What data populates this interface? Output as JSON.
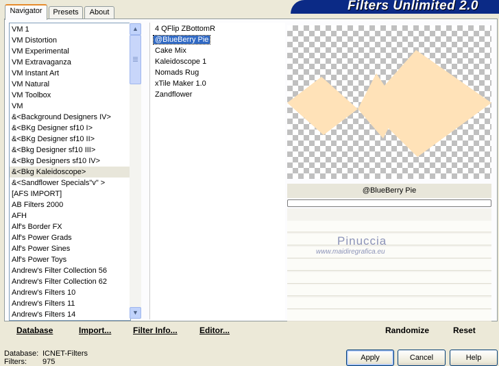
{
  "banner": {
    "title": "Filters Unlimited 2.0"
  },
  "tabs": [
    {
      "label": "Navigator",
      "active": true
    },
    {
      "label": "Presets",
      "active": false
    },
    {
      "label": "About",
      "active": false
    }
  ],
  "categories": {
    "items": [
      "VM 1",
      "VM Distortion",
      "VM Experimental",
      "VM Extravaganza",
      "VM Instant Art",
      "VM Natural",
      "VM Toolbox",
      "VM",
      "&<Background Designers IV>",
      "&<BKg Designer sf10 I>",
      "&<BKg Designer sf10 II>",
      "&<Bkg Designer sf10 III>",
      "&<Bkg Designers sf10 IV>",
      "&<Bkg Kaleidoscope>",
      "&<Sandflower Specials\"v\" >",
      "[AFS IMPORT]",
      "AB Filters 2000",
      "AFH",
      "Alf's Border FX",
      "Alf's Power Grads",
      "Alf's Power Sines",
      "Alf's Power Toys",
      "Andrew's Filter Collection 56",
      "Andrew's Filter Collection 62",
      "Andrew's Filters 10",
      "Andrew's Filters 11",
      "Andrew's Filters 14"
    ],
    "selected_index": 13
  },
  "filters": {
    "items": [
      "4 QFlip ZBottomR",
      "@BlueBerry Pie",
      "Cake Mix",
      "Kaleidoscope 1",
      "Nomads Rug",
      "xTile Maker 1.0",
      "Zandflower"
    ],
    "selected_index": 1
  },
  "preview": {
    "filter_name": "@BlueBerry Pie",
    "shape_color": "#ffe2b8",
    "progress": 0
  },
  "watermark": {
    "name": "Pinuccia",
    "url": "www.maidiregrafica.eu"
  },
  "actions": {
    "database": "Database",
    "import": "Import...",
    "filter_info": "Filter Info...",
    "editor": "Editor...",
    "randomize": "Randomize",
    "reset": "Reset"
  },
  "status": {
    "database_label": "Database:",
    "database_value": "ICNET-Filters",
    "filters_label": "Filters:",
    "filters_value": "975"
  },
  "dialog": {
    "apply": "Apply",
    "cancel": "Cancel",
    "help": "Help"
  },
  "icons": {
    "scroll_up": "chevron-up-icon",
    "scroll_down": "chevron-down-icon"
  }
}
